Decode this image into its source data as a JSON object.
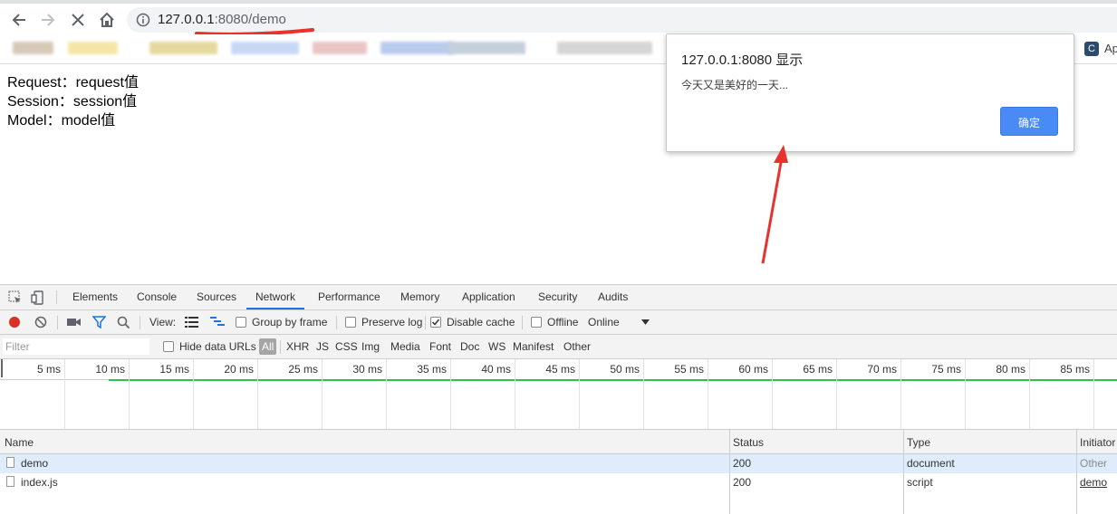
{
  "browser": {
    "url_host": "127.0.0.1",
    "url_rest": ":8080/demo",
    "bookmark_label": "Ap",
    "bookmark_icon": "C"
  },
  "page": {
    "lines": [
      "Request：request值",
      "Session：session值",
      "Model：model值"
    ]
  },
  "dialog": {
    "title": "127.0.0.1:8080 显示",
    "message": "今天又是美好的一天...",
    "ok_label": "确定"
  },
  "devtools": {
    "tabs": [
      "Elements",
      "Console",
      "Sources",
      "Network",
      "Performance",
      "Memory",
      "Application",
      "Security",
      "Audits"
    ],
    "active_tab": "Network",
    "toolbar": {
      "view_label": "View:",
      "group_by_frame": "Group by frame",
      "preserve_log": "Preserve log",
      "disable_cache": "Disable cache",
      "disable_cache_checked": true,
      "offline": "Offline",
      "throttle": "Online"
    },
    "filter": {
      "placeholder": "Filter",
      "hide_data_urls": "Hide data URLs",
      "types": [
        "All",
        "XHR",
        "JS",
        "CSS",
        "Img",
        "Media",
        "Font",
        "Doc",
        "WS",
        "Manifest",
        "Other"
      ]
    },
    "timeline_ticks": [
      "5 ms",
      "10 ms",
      "15 ms",
      "20 ms",
      "25 ms",
      "30 ms",
      "35 ms",
      "40 ms",
      "45 ms",
      "50 ms",
      "55 ms",
      "60 ms",
      "65 ms",
      "70 ms",
      "75 ms",
      "80 ms",
      "85 ms"
    ],
    "table": {
      "columns": [
        "Name",
        "Status",
        "Type",
        "Initiator"
      ],
      "rows": [
        {
          "name": "demo",
          "status": "200",
          "type": "document",
          "initiator": "Other"
        },
        {
          "name": "index.js",
          "status": "200",
          "type": "script",
          "initiator": "demo"
        }
      ]
    }
  },
  "colors": {
    "dialog_button": "#4a8af4",
    "annotation_red": "#e8322e",
    "timeline_green": "#2fbf52",
    "record_red": "#d93025",
    "selected_row": "#dfecfb"
  }
}
